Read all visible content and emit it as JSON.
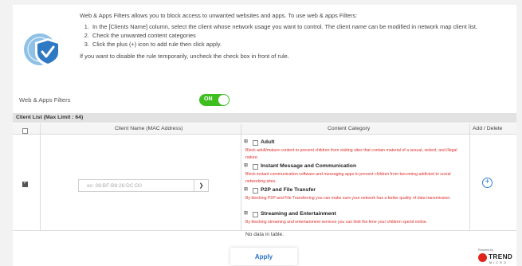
{
  "intro": {
    "paragraph1": "Web & Apps Filters allows you to block access to unwanted websites and apps. To use web & apps Filters:",
    "steps": [
      "In the [Clients Name] column, select the client whose network usage you want to control. The client name can be modified in network map client list.",
      "Check the unwanted content categories",
      "Click the plus (+) icon to add rule then click apply."
    ],
    "paragraph2": "If you want to disable the rule temporarily, uncheck the check box in front of rule."
  },
  "filter_toggle": {
    "label": "Web & Apps Filters",
    "state": "ON"
  },
  "client_list": {
    "title": "Client List (Max Limit : 64)",
    "columns": [
      "Client Name (MAC Address)",
      "Content Category",
      "Add / Delete"
    ],
    "mac_placeholder": "ex: 08:BF:B8:26:DC:D0",
    "row_checked": true,
    "categories": [
      {
        "plus": "⊞",
        "name": "Adult",
        "description": "Block adult/mature content to prevent children from visiting sites that contain material of a sexual, violent, and illegal nature."
      },
      {
        "plus": "⊞",
        "name": "Instant Message and Communication",
        "description": "Block instant communication software and messaging apps to prevent children from becoming addicted to social networking sites."
      },
      {
        "plus": "⊞",
        "name": "P2P and File Transfer",
        "description": "By blocking P2P and File Transferring you can make sure your network has a better quality of data transmission."
      },
      {
        "plus": "⊞",
        "name": "Streaming and Entertainment",
        "description": "By blocking streaming and entertainment services you can limit the time your children spend online."
      }
    ],
    "add_icon": "plus-circle-icon",
    "empty_text": "No data in table."
  },
  "apply_label": "Apply",
  "brand": {
    "powered": "Powered by",
    "name": "TREND",
    "sub": "MICRO"
  },
  "colors": {
    "toggle_on": "#3fbf1f",
    "accent": "#2a73c8",
    "warning_text": "#e0302b",
    "brand_red": "#e0231b"
  }
}
